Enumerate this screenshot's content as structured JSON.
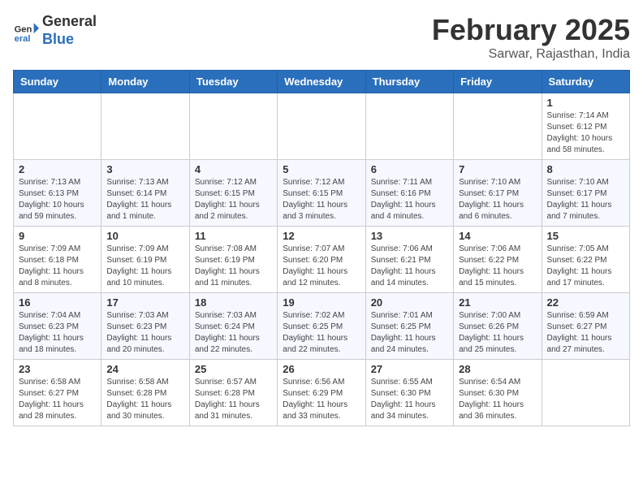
{
  "logo": {
    "general": "General",
    "blue": "Blue"
  },
  "header": {
    "month": "February 2025",
    "location": "Sarwar, Rajasthan, India"
  },
  "weekdays": [
    "Sunday",
    "Monday",
    "Tuesday",
    "Wednesday",
    "Thursday",
    "Friday",
    "Saturday"
  ],
  "weeks": [
    [
      {
        "day": "",
        "info": ""
      },
      {
        "day": "",
        "info": ""
      },
      {
        "day": "",
        "info": ""
      },
      {
        "day": "",
        "info": ""
      },
      {
        "day": "",
        "info": ""
      },
      {
        "day": "",
        "info": ""
      },
      {
        "day": "1",
        "info": "Sunrise: 7:14 AM\nSunset: 6:12 PM\nDaylight: 10 hours\nand 58 minutes."
      }
    ],
    [
      {
        "day": "2",
        "info": "Sunrise: 7:13 AM\nSunset: 6:13 PM\nDaylight: 10 hours\nand 59 minutes."
      },
      {
        "day": "3",
        "info": "Sunrise: 7:13 AM\nSunset: 6:14 PM\nDaylight: 11 hours\nand 1 minute."
      },
      {
        "day": "4",
        "info": "Sunrise: 7:12 AM\nSunset: 6:15 PM\nDaylight: 11 hours\nand 2 minutes."
      },
      {
        "day": "5",
        "info": "Sunrise: 7:12 AM\nSunset: 6:15 PM\nDaylight: 11 hours\nand 3 minutes."
      },
      {
        "day": "6",
        "info": "Sunrise: 7:11 AM\nSunset: 6:16 PM\nDaylight: 11 hours\nand 4 minutes."
      },
      {
        "day": "7",
        "info": "Sunrise: 7:10 AM\nSunset: 6:17 PM\nDaylight: 11 hours\nand 6 minutes."
      },
      {
        "day": "8",
        "info": "Sunrise: 7:10 AM\nSunset: 6:17 PM\nDaylight: 11 hours\nand 7 minutes."
      }
    ],
    [
      {
        "day": "9",
        "info": "Sunrise: 7:09 AM\nSunset: 6:18 PM\nDaylight: 11 hours\nand 8 minutes."
      },
      {
        "day": "10",
        "info": "Sunrise: 7:09 AM\nSunset: 6:19 PM\nDaylight: 11 hours\nand 10 minutes."
      },
      {
        "day": "11",
        "info": "Sunrise: 7:08 AM\nSunset: 6:19 PM\nDaylight: 11 hours\nand 11 minutes."
      },
      {
        "day": "12",
        "info": "Sunrise: 7:07 AM\nSunset: 6:20 PM\nDaylight: 11 hours\nand 12 minutes."
      },
      {
        "day": "13",
        "info": "Sunrise: 7:06 AM\nSunset: 6:21 PM\nDaylight: 11 hours\nand 14 minutes."
      },
      {
        "day": "14",
        "info": "Sunrise: 7:06 AM\nSunset: 6:22 PM\nDaylight: 11 hours\nand 15 minutes."
      },
      {
        "day": "15",
        "info": "Sunrise: 7:05 AM\nSunset: 6:22 PM\nDaylight: 11 hours\nand 17 minutes."
      }
    ],
    [
      {
        "day": "16",
        "info": "Sunrise: 7:04 AM\nSunset: 6:23 PM\nDaylight: 11 hours\nand 18 minutes."
      },
      {
        "day": "17",
        "info": "Sunrise: 7:03 AM\nSunset: 6:23 PM\nDaylight: 11 hours\nand 20 minutes."
      },
      {
        "day": "18",
        "info": "Sunrise: 7:03 AM\nSunset: 6:24 PM\nDaylight: 11 hours\nand 22 minutes."
      },
      {
        "day": "19",
        "info": "Sunrise: 7:02 AM\nSunset: 6:25 PM\nDaylight: 11 hours\nand 22 minutes."
      },
      {
        "day": "20",
        "info": "Sunrise: 7:01 AM\nSunset: 6:25 PM\nDaylight: 11 hours\nand 24 minutes."
      },
      {
        "day": "21",
        "info": "Sunrise: 7:00 AM\nSunset: 6:26 PM\nDaylight: 11 hours\nand 25 minutes."
      },
      {
        "day": "22",
        "info": "Sunrise: 6:59 AM\nSunset: 6:27 PM\nDaylight: 11 hours\nand 27 minutes."
      }
    ],
    [
      {
        "day": "23",
        "info": "Sunrise: 6:58 AM\nSunset: 6:27 PM\nDaylight: 11 hours\nand 28 minutes."
      },
      {
        "day": "24",
        "info": "Sunrise: 6:58 AM\nSunset: 6:28 PM\nDaylight: 11 hours\nand 30 minutes."
      },
      {
        "day": "25",
        "info": "Sunrise: 6:57 AM\nSunset: 6:28 PM\nDaylight: 11 hours\nand 31 minutes."
      },
      {
        "day": "26",
        "info": "Sunrise: 6:56 AM\nSunset: 6:29 PM\nDaylight: 11 hours\nand 33 minutes."
      },
      {
        "day": "27",
        "info": "Sunrise: 6:55 AM\nSunset: 6:30 PM\nDaylight: 11 hours\nand 34 minutes."
      },
      {
        "day": "28",
        "info": "Sunrise: 6:54 AM\nSunset: 6:30 PM\nDaylight: 11 hours\nand 36 minutes."
      },
      {
        "day": "",
        "info": ""
      }
    ]
  ]
}
